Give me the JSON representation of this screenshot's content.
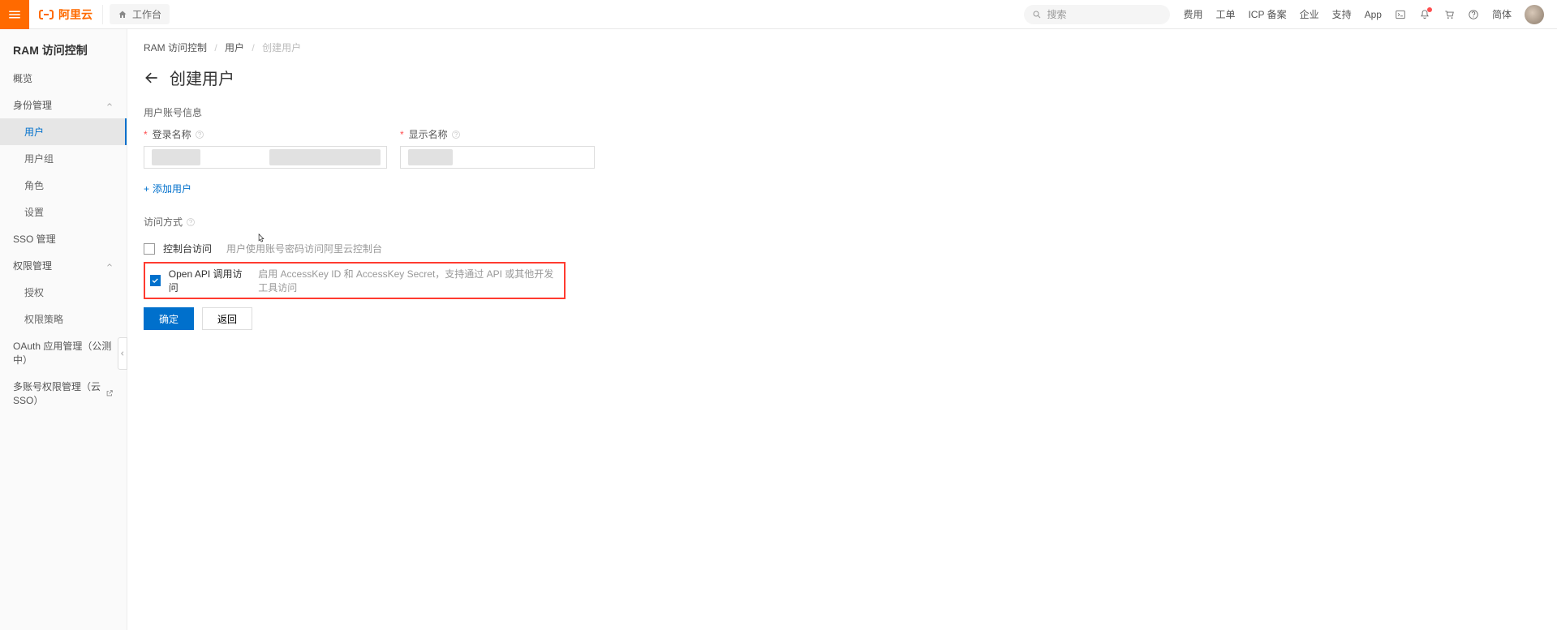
{
  "header": {
    "brand": "阿里云",
    "workbench": "工作台",
    "search_placeholder": "搜索",
    "links": {
      "cost": "费用",
      "ticket": "工单",
      "icp": "ICP 备案",
      "enterprise": "企业",
      "support": "支持",
      "app": "App",
      "lang": "简体"
    }
  },
  "sidebar": {
    "title": "RAM 访问控制",
    "overview": "概览",
    "identity_mgmt": "身份管理",
    "users": "用户",
    "user_groups": "用户组",
    "roles": "角色",
    "settings": "设置",
    "sso_mgmt": "SSO 管理",
    "perm_mgmt": "权限管理",
    "grants": "授权",
    "policies": "权限策略",
    "oauth_mgmt": "OAuth 应用管理（公测中）",
    "multi_account": "多账号权限管理（云 SSO）"
  },
  "breadcrumb": {
    "ram": "RAM 访问控制",
    "users": "用户",
    "create": "创建用户"
  },
  "page": {
    "title": "创建用户",
    "account_info": "用户账号信息",
    "login_name": "登录名称",
    "display_name": "显示名称",
    "add_user": "添加用户",
    "access_method": "访问方式",
    "console_access": "控制台访问",
    "console_desc": "用户使用账号密码访问阿里云控制台",
    "api_access": "Open API 调用访问",
    "api_desc": "启用 AccessKey ID 和 AccessKey Secret，支持通过 API 或其他开发工具访问",
    "confirm": "确定",
    "back": "返回"
  }
}
